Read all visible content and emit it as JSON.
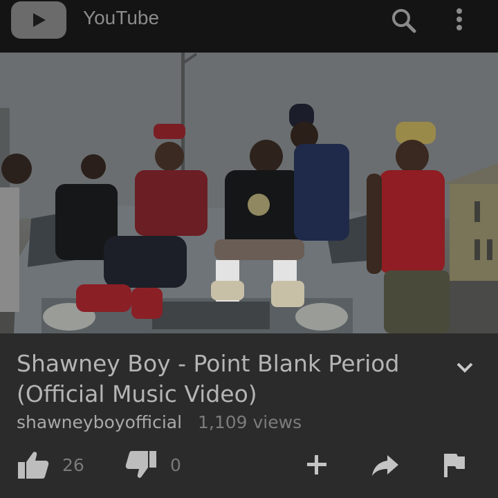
{
  "app": {
    "title": "YouTube"
  },
  "video": {
    "title": "Shawney Boy - Point Blank Period (Official Music Video)",
    "channel": "shawneyboyofficial",
    "views": "1,109 views"
  },
  "actions": {
    "likes": "26",
    "dislikes": "0"
  },
  "icons": [
    "youtube-logo-icon",
    "search-icon",
    "more-vert-icon",
    "chevron-down-icon",
    "thumbs-up-icon",
    "thumbs-down-icon",
    "add-icon",
    "share-icon",
    "flag-icon"
  ],
  "colors": {
    "top_bar": "#141414",
    "info_bg": "#2b2b2b",
    "text": "#b5b5b5"
  }
}
